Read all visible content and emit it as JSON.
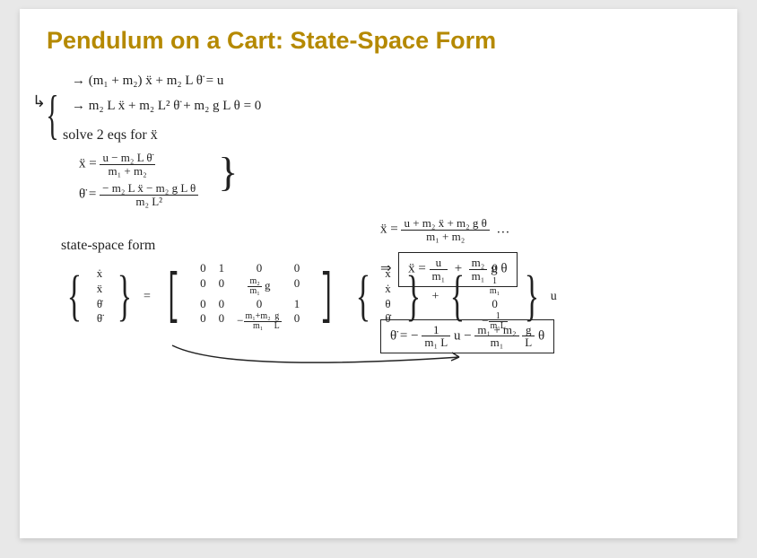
{
  "title": "Pendulum on a Cart: State-Space Form",
  "system": {
    "eq1": "→  (m₁ + m₂) ẍ  +  m₂ L θ̈  =  u",
    "eq2": "→  m₂ L ẍ  +  m₂ L² θ̈  +  m₂ g L θ  =  0"
  },
  "instruction": "solve  2 eqs  for  ẍ",
  "left_pair": {
    "xdd_lhs": "ẍ  =",
    "xdd_num": "u − m₂ L θ̈",
    "xdd_den": "m₁ + m₂",
    "tdd_lhs": "θ̈  =",
    "tdd_num": "− m₂ L ẍ − m₂ g L θ",
    "tdd_den": "m₂ L²"
  },
  "right_top": {
    "xdd_lhs": "ẍ  =",
    "xdd_num": "u + m₂ ẍ + m₂ g θ",
    "xdd_den": "m₁ + m₂",
    "trail": "…"
  },
  "boxed": {
    "xdd": "ẍ  =",
    "xdd_f1n": "u",
    "xdd_f1d": "m₁",
    "xdd_plus": "+",
    "xdd_f2n": "m₂",
    "xdd_f2d": "m₁",
    "xdd_tail": "g θ",
    "tdd": "θ̈  =  −",
    "tdd_f1n": "1",
    "tdd_f1d": "m₁ L",
    "tdd_mid": "u  −",
    "tdd_f2n": "m₁ + m₂",
    "tdd_f2d": "m₁",
    "tdd_f3n": "g",
    "tdd_f3d": "L",
    "tdd_tail": "θ"
  },
  "ss_label": "state-space form",
  "state_vec": [
    "ẋ",
    "ẍ",
    "θ̇",
    "θ̈"
  ],
  "A": {
    "r1": [
      "0",
      "1",
      "0",
      "0"
    ],
    "r2": [
      "0",
      "0",
      "(m₂/m₁) g",
      "0"
    ],
    "r3": [
      "0",
      "0",
      "0",
      "1"
    ],
    "r4": [
      "0",
      "0",
      "−((m₁+m₂)/m₁)(g/L)",
      "0"
    ]
  },
  "x_vec": [
    "x",
    "ẋ",
    "θ",
    "θ̇"
  ],
  "B": [
    "0",
    "1/m₁",
    "0",
    "−1/(m₁L)"
  ],
  "u_label": "u",
  "eq_sign": "=",
  "plus_sign": "+",
  "imply": "⇒"
}
